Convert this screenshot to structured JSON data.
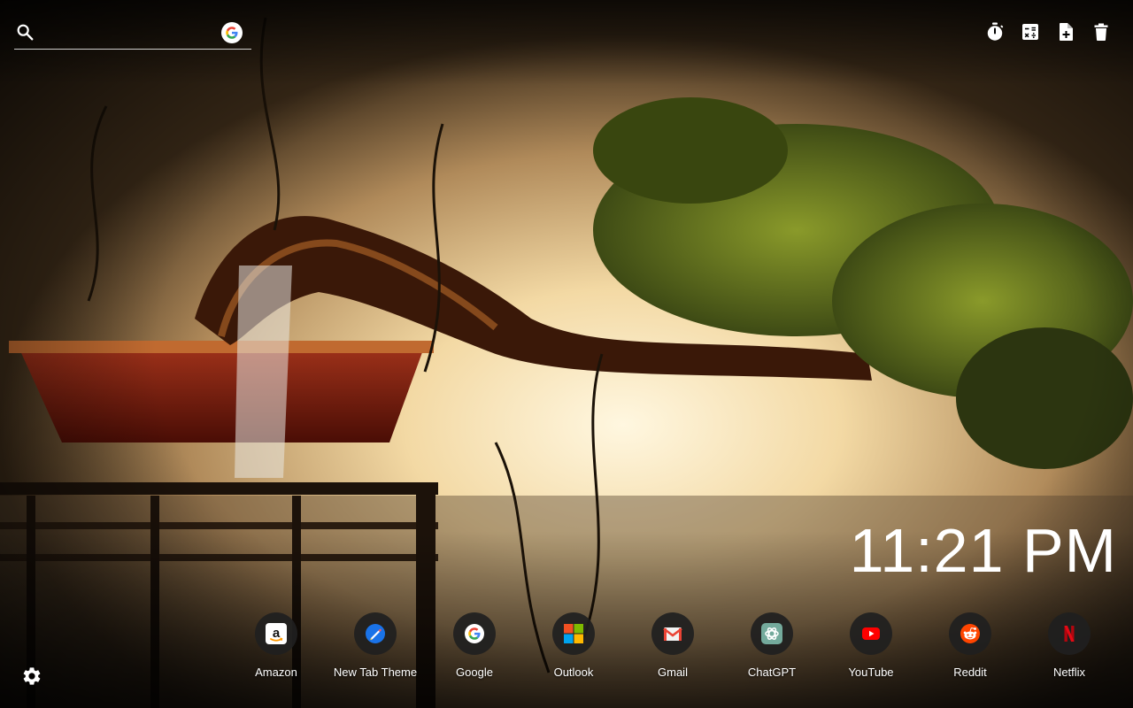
{
  "search": {
    "value": "",
    "placeholder": "",
    "icon": "search-icon",
    "engine_icon": "google-icon"
  },
  "toolbar": {
    "tools": [
      {
        "icon": "timer-icon"
      },
      {
        "icon": "calculator-icon"
      },
      {
        "icon": "note-add-icon"
      },
      {
        "icon": "trash-icon"
      }
    ]
  },
  "clock": {
    "time": "11:21 PM"
  },
  "shortcuts": [
    {
      "label": "Amazon",
      "icon": "amazon-icon"
    },
    {
      "label": "New Tab Theme",
      "icon": "new-tab-theme-icon"
    },
    {
      "label": "Google",
      "icon": "google-icon"
    },
    {
      "label": "Outlook",
      "icon": "outlook-icon"
    },
    {
      "label": "Gmail",
      "icon": "gmail-icon"
    },
    {
      "label": "ChatGPT",
      "icon": "chatgpt-icon"
    },
    {
      "label": "YouTube",
      "icon": "youtube-icon"
    },
    {
      "label": "Reddit",
      "icon": "reddit-icon"
    },
    {
      "label": "Netflix",
      "icon": "netflix-icon"
    }
  ],
  "settings": {
    "icon": "gear-icon"
  },
  "colors": {
    "text": "#ffffff",
    "shortcut_bg": "#202020",
    "youtube_red": "#ff0000",
    "reddit_orange": "#ff4500",
    "netflix_red": "#e50914",
    "chatgpt_green": "#74aa9c"
  }
}
